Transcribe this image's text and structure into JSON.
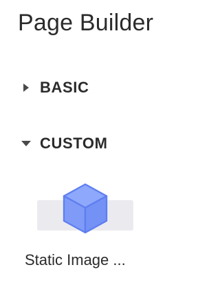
{
  "header": {
    "title": "Page Builder"
  },
  "sections": [
    {
      "label": "BASIC",
      "expanded": false,
      "icon": "caret-right-icon"
    },
    {
      "label": "CUSTOM",
      "expanded": true,
      "icon": "caret-down-icon"
    }
  ],
  "custom_components": [
    {
      "label": "Static Image ...",
      "icon": "cube-icon"
    }
  ],
  "colors": {
    "accent": "#7f9bf7",
    "accent_stroke": "#5f7ff0",
    "preview_bg": "#ebebef",
    "text": "#2b2b2b"
  }
}
